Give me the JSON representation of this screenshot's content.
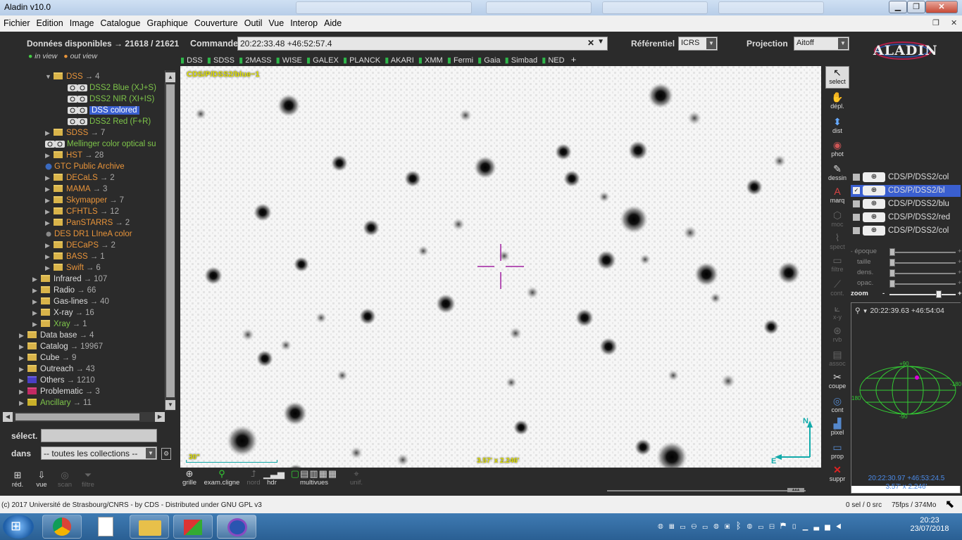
{
  "window": {
    "title": "Aladin v10.0"
  },
  "menu": [
    "Fichier",
    "Edition",
    "Image",
    "Catalogue",
    "Graphique",
    "Couverture",
    "Outil",
    "Vue",
    "Interop",
    "Aide"
  ],
  "top": {
    "data_label": "Données disponibles",
    "arrow": "→",
    "data_count": "21618 / 21621",
    "in_view": "in view",
    "out_view": "out view",
    "command_label": "Commande",
    "command_value": "20:22:33.48 +46:52:57.4",
    "ref_label": "Référentiel",
    "ref_value": "ICRS",
    "proj_label": "Projection",
    "proj_value": "Aitoff",
    "logo": "ALADIN"
  },
  "catalog_buttons": [
    "DSS",
    "SDSS",
    "2MASS",
    "WISE",
    "GALEX",
    "PLANCK",
    "AKARI",
    "XMM",
    "Fermi",
    "Gaia",
    "Simbad",
    "NED"
  ],
  "catalog_add": "+",
  "tree": [
    {
      "name": "DSS",
      "count": "4",
      "indent": 1,
      "color": "orange"
    },
    {
      "name": "DSS2 Blue (XJ+S)",
      "indent": 2,
      "color": "green",
      "leaf": true
    },
    {
      "name": "DSS2 NIR (XI+IS)",
      "indent": 2,
      "color": "green",
      "leaf": true
    },
    {
      "name": "DSS colored",
      "indent": 2,
      "color": "sel",
      "leaf": true
    },
    {
      "name": "DSS2 Red (F+R)",
      "indent": 2,
      "color": "green",
      "leaf": true
    },
    {
      "name": "SDSS",
      "count": "7",
      "indent": 1,
      "color": "orange"
    },
    {
      "name": "Mellinger color optical su",
      "indent": 1,
      "color": "green",
      "leaf": true
    },
    {
      "name": "HST",
      "count": "28",
      "indent": 1,
      "color": "orange"
    },
    {
      "name": "GTC Public Archive",
      "indent": 1,
      "color": "orangeplain",
      "leaf": true
    },
    {
      "name": "DECaLS",
      "count": "2",
      "indent": 1,
      "color": "orange"
    },
    {
      "name": "MAMA",
      "count": "3",
      "indent": 1,
      "color": "orange"
    },
    {
      "name": "Skymapper",
      "count": "7",
      "indent": 1,
      "color": "orange"
    },
    {
      "name": "CFHTLS",
      "count": "12",
      "indent": 1,
      "color": "orange"
    },
    {
      "name": "PanSTARRS",
      "count": "2",
      "indent": 1,
      "color": "orange"
    },
    {
      "name": "DES DR1 LIneA color",
      "indent": 1,
      "color": "orangeplain",
      "leaf": true
    },
    {
      "name": "DECaPS",
      "count": "2",
      "indent": 1,
      "color": "orange"
    },
    {
      "name": "BASS",
      "count": "1",
      "indent": 1,
      "color": "orange"
    },
    {
      "name": "Swift",
      "count": "6",
      "indent": 1,
      "color": "orange"
    },
    {
      "name": "Infrared",
      "count": "107",
      "indent": 0,
      "color": "white"
    },
    {
      "name": "Radio",
      "count": "66",
      "indent": 0,
      "color": "white"
    },
    {
      "name": "Gas-lines",
      "count": "40",
      "indent": 0,
      "color": "white"
    },
    {
      "name": "X-ray",
      "count": "16",
      "indent": 0,
      "color": "white"
    },
    {
      "name": "Xray",
      "count": "1",
      "indent": 0,
      "color": "green"
    },
    {
      "name": "Data base",
      "count": "4",
      "indent": -1,
      "color": "white"
    },
    {
      "name": "Catalog",
      "count": "19967",
      "indent": -1,
      "color": "white"
    },
    {
      "name": "Cube",
      "count": "9",
      "indent": -1,
      "color": "white"
    },
    {
      "name": "Outreach",
      "count": "43",
      "indent": -1,
      "color": "white"
    },
    {
      "name": "Others",
      "count": "1210",
      "indent": -1,
      "color": "white",
      "folder": "blue"
    },
    {
      "name": "Problematic",
      "count": "3",
      "indent": -1,
      "color": "white",
      "folder": "red"
    },
    {
      "name": "Ancillary",
      "count": "11",
      "indent": -1,
      "color": "green",
      "folder": "yel"
    }
  ],
  "filter": {
    "select_label": "sélect.",
    "in_label": "dans",
    "collections_value": "-- toutes les collections --"
  },
  "left_tools": [
    "réd.",
    "vue",
    "scan",
    "filtre"
  ],
  "view": {
    "survey_label": "CDS/P/DSS2/blue~1",
    "scale": "30\"",
    "size": "3.57' x 2.246'",
    "north": "N",
    "east": "E"
  },
  "right_tools": [
    "select",
    "dépl.",
    "dist",
    "phot",
    "dessin",
    "marq",
    "moc",
    "spect",
    "filtre",
    "cont.",
    "x-y",
    "rvb",
    "assoc",
    "coupe",
    "cont",
    "pixel",
    "prop",
    "suppr"
  ],
  "stack": [
    "CDS/P/DSS2/col",
    "CDS/P/DSS2/bl",
    "CDS/P/DSS2/blu",
    "CDS/P/DSS2/red",
    "CDS/P/DSS2/col"
  ],
  "sliders": [
    "époque",
    "taille",
    "dens.",
    "opac.",
    "zoom"
  ],
  "navigator": {
    "coords": "20:22:39.63 +46:54:04",
    "top_label": "+90",
    "bottom_label": "-90",
    "left_label": "180",
    "right_label": "-180",
    "foot_coords": "20:22:30.97 +46:53:24.5",
    "foot_size": "3.57' x 2.246'"
  },
  "bottom_tools": [
    "grille",
    "exam.cligne",
    "nord",
    "hdr",
    "multivues",
    "unif."
  ],
  "status": {
    "left": "(c) 2017 Université de Strasbourg/CNRS - by CDS - Distributed under GNU GPL v3",
    "sel": "0 sel / 0 src",
    "fps": "75fps / 374Mo"
  },
  "taskbar": {
    "time": "20:23",
    "date": "23/07/2018"
  }
}
